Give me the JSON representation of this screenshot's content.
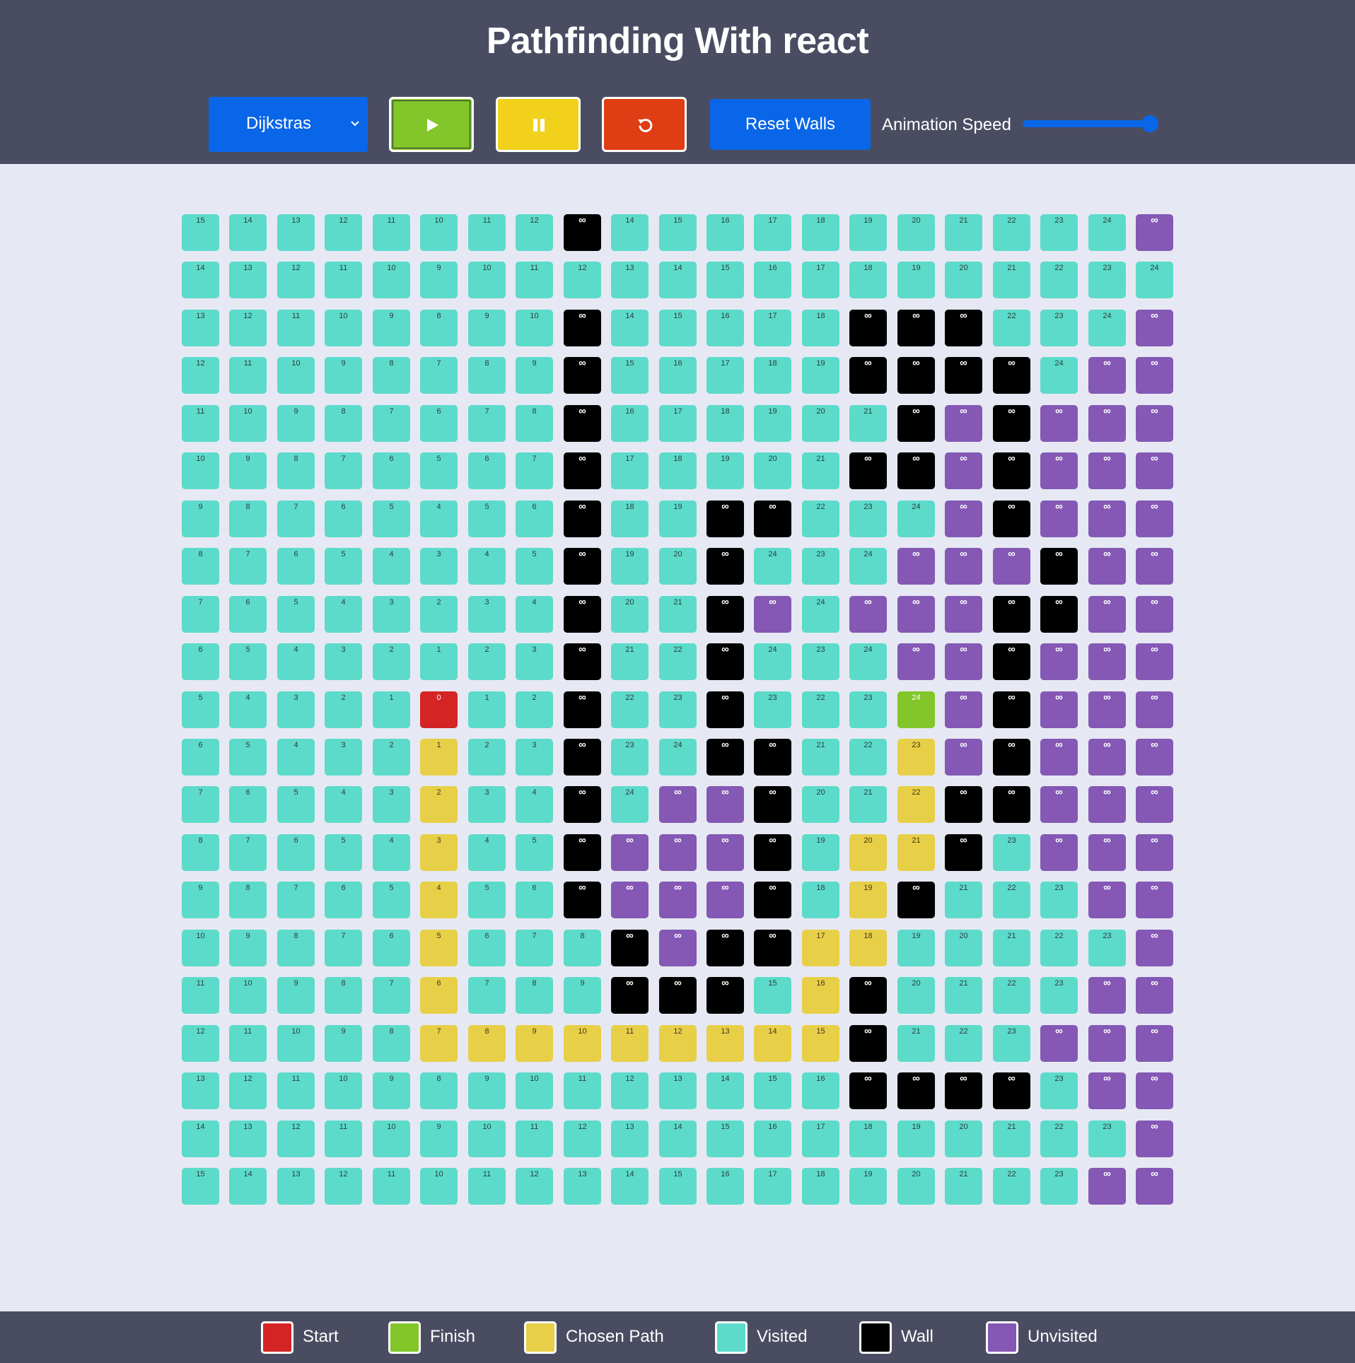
{
  "header": {
    "title": "Pathfinding With react"
  },
  "controls": {
    "algorithm_selected": "Dijkstras",
    "reset_walls_label": "Reset Walls",
    "speed_label": "Animation Speed",
    "speed_value": 1.0
  },
  "colors": {
    "header_bg": "#4a4d62",
    "page_bg": "#e6e9f3",
    "primary_blue": "#0a66e8",
    "play": "#82c629",
    "pause": "#f1d11b",
    "reset": "#df3d14",
    "start": "#d42424",
    "finish": "#82c629",
    "path": "#e7cf48",
    "visited": "#5cdbcb",
    "wall": "#000000",
    "unvisited": "#8458b4"
  },
  "grid": {
    "rows": [
      "v:15 v:14 v:13 v:12 v:11 v:10 v:11 v:12 w:∞ v:14 v:15 v:16 v:17 v:18 v:19 v:20 v:21 v:22 v:23 v:24 u:∞",
      "v:14 v:13 v:12 v:11 v:10 v:9 v:10 v:11 v:12 v:13 v:14 v:15 v:16 v:17 v:18 v:19 v:20 v:21 v:22 v:23 v:24",
      "v:13 v:12 v:11 v:10 v:9 v:8 v:9 v:10 w:∞ v:14 v:15 v:16 v:17 v:18 w:∞ w:∞ w:∞ v:22 v:23 v:24 u:∞",
      "v:12 v:11 v:10 v:9 v:8 v:7 v:8 v:9 w:∞ v:15 v:16 v:17 v:18 v:19 w:∞ w:∞ w:∞ w:∞ v:24 u:∞ u:∞",
      "v:11 v:10 v:9 v:8 v:7 v:6 v:7 v:8 w:∞ v:16 v:17 v:18 v:19 v:20 v:21 w:∞ u:∞ w:∞ u:∞ u:∞ u:∞",
      "v:10 v:9 v:8 v:7 v:6 v:5 v:6 v:7 w:∞ v:17 v:18 v:19 v:20 v:21 w:∞ w:∞ u:∞ w:∞ u:∞ u:∞ u:∞",
      "v:9 v:8 v:7 v:6 v:5 v:4 v:5 v:6 w:∞ v:18 v:19 w:∞ w:∞ v:22 v:23 v:24 u:∞ w:∞ u:∞ u:∞ u:∞",
      "v:8 v:7 v:6 v:5 v:4 v:3 v:4 v:5 w:∞ v:19 v:20 w:∞ v:24 v:23 v:24 u:∞ u:∞ u:∞ w:∞ u:∞ u:∞",
      "v:7 v:6 v:5 v:4 v:3 v:2 v:3 v:4 w:∞ v:20 v:21 w:∞ u:∞ v:24 u:∞ u:∞ u:∞ w:∞ w:∞ u:∞ u:∞",
      "v:6 v:5 v:4 v:3 v:2 v:1 v:2 v:3 w:∞ v:21 v:22 w:∞ v:24 v:23 v:24 u:∞ u:∞ w:∞ u:∞ u:∞ u:∞",
      "v:5 v:4 v:3 v:2 v:1 s:0 v:1 v:2 w:∞ v:22 v:23 w:∞ v:23 v:22 v:23 f:24 u:∞ w:∞ u:∞ u:∞ u:∞",
      "v:6 v:5 v:4 v:3 v:2 p:1 v:2 v:3 w:∞ v:23 v:24 w:∞ w:∞ v:21 v:22 p:23 u:∞ w:∞ u:∞ u:∞ u:∞",
      "v:7 v:6 v:5 v:4 v:3 p:2 v:3 v:4 w:∞ v:24 u:∞ u:∞ w:∞ v:20 v:21 p:22 w:∞ w:∞ u:∞ u:∞ u:∞",
      "v:8 v:7 v:6 v:5 v:4 p:3 v:4 v:5 w:∞ u:∞ u:∞ u:∞ w:∞ v:19 p:20 p:21 w:∞ v:23 u:∞ u:∞ u:∞",
      "v:9 v:8 v:7 v:6 v:5 p:4 v:5 v:6 w:∞ u:∞ u:∞ u:∞ w:∞ v:18 p:19 w:∞ v:21 v:22 v:23 u:∞ u:∞",
      "v:10 v:9 v:8 v:7 v:6 p:5 v:6 v:7 v:8 w:∞ u:∞ w:∞ w:∞ p:17 p:18 v:19 v:20 v:21 v:22 v:23 u:∞",
      "v:11 v:10 v:9 v:8 v:7 p:6 v:7 v:8 v:9 w:∞ w:∞ w:∞ v:15 p:16 w:∞ v:20 v:21 v:22 v:23 u:∞ u:∞",
      "v:12 v:11 v:10 v:9 v:8 p:7 p:8 p:9 p:10 p:11 p:12 p:13 p:14 p:15 w:∞ v:21 v:22 v:23 u:∞ u:∞ u:∞",
      "v:13 v:12 v:11 v:10 v:9 v:8 v:9 v:10 v:11 v:12 v:13 v:14 v:15 v:16 w:∞ w:∞ w:∞ w:∞ v:23 u:∞ u:∞",
      "v:14 v:13 v:12 v:11 v:10 v:9 v:10 v:11 v:12 v:13 v:14 v:15 v:16 v:17 v:18 v:19 v:20 v:21 v:22 v:23 u:∞",
      "v:15 v:14 v:13 v:12 v:11 v:10 v:11 v:12 v:13 v:14 v:15 v:16 v:17 v:18 v:19 v:20 v:21 v:22 v:23 u:∞ u:∞"
    ]
  },
  "legend": [
    {
      "label": "Start",
      "color": "#d42424"
    },
    {
      "label": "Finish",
      "color": "#82c629"
    },
    {
      "label": "Chosen Path",
      "color": "#e7cf48"
    },
    {
      "label": "Visited",
      "color": "#5cdbcb"
    },
    {
      "label": "Wall",
      "color": "#000000"
    },
    {
      "label": "Unvisited",
      "color": "#8458b4"
    }
  ]
}
